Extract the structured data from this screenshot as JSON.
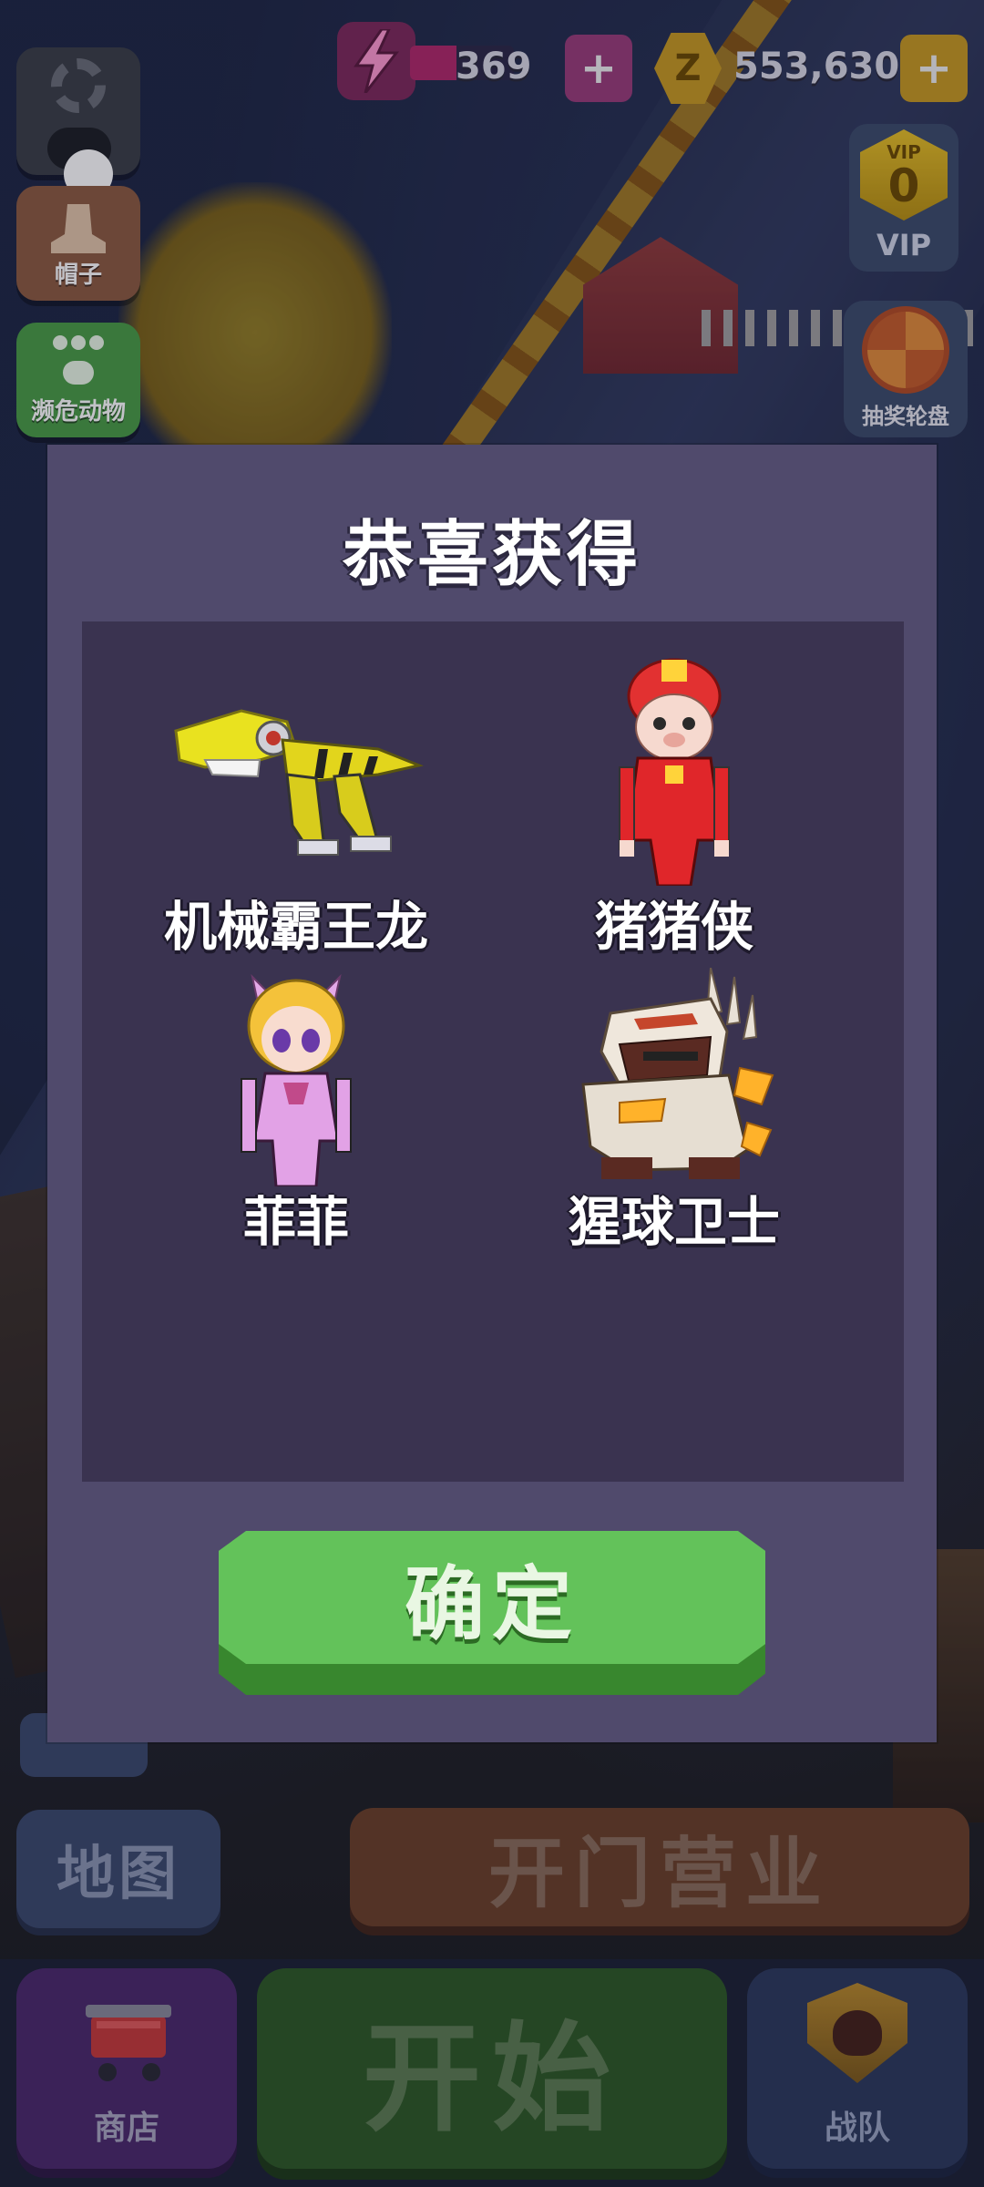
{
  "hud": {
    "energy_value": "369",
    "energy_fill_percent": 45,
    "energy_plus": "+",
    "coin_symbol": "Z",
    "coin_value": "553,630",
    "coin_plus": "+"
  },
  "left_menu": {
    "hat_label": "帽子",
    "animal_label": "濒危动物"
  },
  "right_menu": {
    "vip_small": "VIP",
    "vip_level": "0",
    "vip_label": "VIP",
    "lottery_label": "抽奖轮盘"
  },
  "bottom": {
    "map_label": "地图",
    "open_label": "开门营业",
    "shop_label": "商店",
    "start_label": "开始",
    "team_label": "战队"
  },
  "modal": {
    "title": "恭喜获得",
    "items": [
      {
        "name": "机械霸王龙",
        "icon": "mech-trex-icon"
      },
      {
        "name": "猪猪侠",
        "icon": "pig-hero-icon"
      },
      {
        "name": "菲菲",
        "icon": "feifei-icon"
      },
      {
        "name": "猩球卫士",
        "icon": "ape-guard-icon"
      }
    ],
    "confirm_label": "确定"
  },
  "colors": {
    "modal_bg": "#504a6c",
    "panel_bg": "#3a3350",
    "confirm_green": "#63c25a"
  }
}
